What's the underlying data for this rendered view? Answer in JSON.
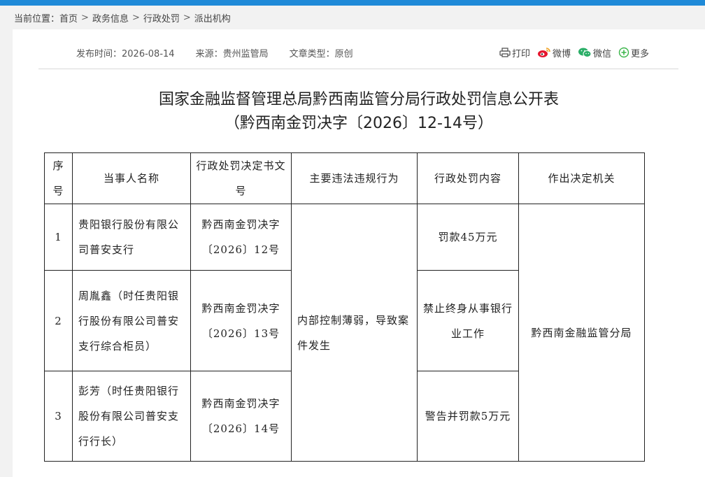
{
  "breadcrumb": {
    "prefix": "当前位置：",
    "items": [
      "首页",
      "政务信息",
      "行政处罚",
      "派出机构"
    ],
    "separator": ">"
  },
  "meta": {
    "publish_time": "发布时间：2026-08-14",
    "source": "来源：贵州监管局",
    "doc_type": "文章类型：原创"
  },
  "share": {
    "print": "打印",
    "weibo": "微博",
    "wechat": "微信",
    "more": "更多"
  },
  "title": {
    "line1": "国家金融监督管理总局黔西南监管分局行政处罚信息公开表",
    "line2": "（黔西南金罚决字〔2026〕12-14号）"
  },
  "table": {
    "headers": [
      "序号",
      "当事人名称",
      "行政处罚决定书文号",
      "主要违法违规行为",
      "行政处罚内容",
      "作出决定机关"
    ],
    "violation": "内部控制薄弱，导致案件发生",
    "authority": "黔西南金融监管分局",
    "rows": [
      {
        "no": "1",
        "party": "贵阳银行股份有限公司普安支行",
        "doc": "黔西南金罚决字〔2026〕12号",
        "penalty": "罚款45万元"
      },
      {
        "no": "2",
        "party": "周胤鑫（时任贵阳银行股份有限公司普安支行综合柜员）",
        "doc": "黔西南金罚决字〔2026〕13号",
        "penalty": "禁止终身从事银行业工作"
      },
      {
        "no": "3",
        "party": "彭芳（时任贵阳银行股份有限公司普安支行行长）",
        "doc": "黔西南金罚决字〔2026〕14号",
        "penalty": "警告并罚款5万元"
      }
    ]
  },
  "colors": {
    "topbar": "#1f8ad8",
    "page_bg": "#f2f2f2",
    "weibo": "#e6162d",
    "wechat": "#2aae67",
    "more": "#3bb54a"
  }
}
